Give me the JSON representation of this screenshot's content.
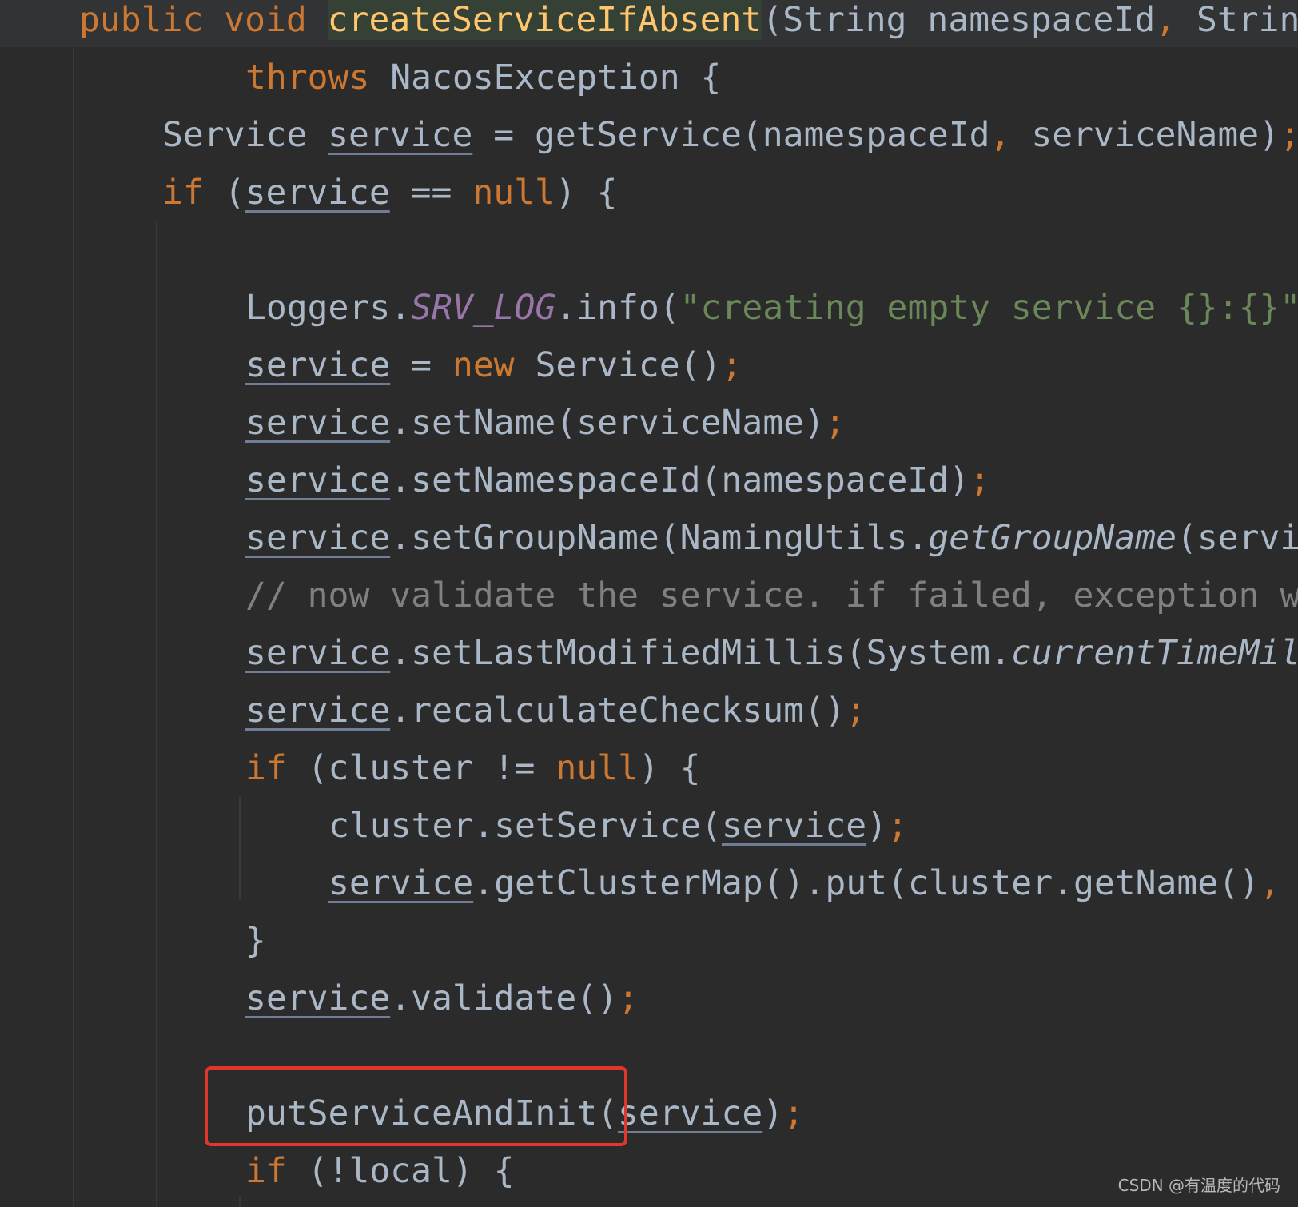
{
  "editor": {
    "theme_colors": {
      "background": "#2b2b2b",
      "keyword": "#cc7832",
      "plain": "#a9b7c6",
      "method_declaration": "#ffc66d",
      "string": "#6a8759",
      "comment": "#808080",
      "static_field": "#9876aa",
      "highlight_box": "#e0372a"
    },
    "highlighted_line": 19,
    "lines": [
      {
        "indent": 0,
        "tokens": [
          {
            "t": "public void ",
            "c": "kw"
          },
          {
            "t": "createServiceIfAbsent",
            "c": "md"
          },
          {
            "t": "(String namespaceId",
            "c": "pl"
          },
          {
            "t": ", ",
            "c": "kw"
          },
          {
            "t": "Strin",
            "c": "pl"
          }
        ]
      },
      {
        "indent": 8,
        "tokens": [
          {
            "t": "throws ",
            "c": "kw"
          },
          {
            "t": "NacosException {",
            "c": "pl"
          }
        ]
      },
      {
        "indent": 4,
        "tokens": [
          {
            "t": "Service ",
            "c": "pl"
          },
          {
            "t": "service",
            "c": "pl ul"
          },
          {
            "t": " = getService(namespaceId",
            "c": "pl"
          },
          {
            "t": ", ",
            "c": "kw"
          },
          {
            "t": "serviceName)",
            "c": "pl"
          },
          {
            "t": ";",
            "c": "kw"
          }
        ]
      },
      {
        "indent": 4,
        "tokens": [
          {
            "t": "if ",
            "c": "kw"
          },
          {
            "t": "(",
            "c": "pl"
          },
          {
            "t": "service",
            "c": "pl ul"
          },
          {
            "t": " == ",
            "c": "pl"
          },
          {
            "t": "null",
            "c": "kw"
          },
          {
            "t": ") {",
            "c": "pl"
          }
        ]
      },
      {
        "indent": 0,
        "tokens": []
      },
      {
        "indent": 8,
        "tokens": [
          {
            "t": "Loggers.",
            "c": "pl"
          },
          {
            "t": "SRV_LOG",
            "c": "sf"
          },
          {
            "t": ".info(",
            "c": "pl"
          },
          {
            "t": "\"creating empty service {}:{}\"",
            "c": "st"
          }
        ]
      },
      {
        "indent": 8,
        "tokens": [
          {
            "t": "service",
            "c": "pl ul"
          },
          {
            "t": " = ",
            "c": "pl"
          },
          {
            "t": "new ",
            "c": "kw"
          },
          {
            "t": "Service()",
            "c": "pl"
          },
          {
            "t": ";",
            "c": "kw"
          }
        ]
      },
      {
        "indent": 8,
        "tokens": [
          {
            "t": "service",
            "c": "pl ul"
          },
          {
            "t": ".setName(serviceName)",
            "c": "pl"
          },
          {
            "t": ";",
            "c": "kw"
          }
        ]
      },
      {
        "indent": 8,
        "tokens": [
          {
            "t": "service",
            "c": "pl ul"
          },
          {
            "t": ".setNamespaceId(namespaceId)",
            "c": "pl"
          },
          {
            "t": ";",
            "c": "kw"
          }
        ]
      },
      {
        "indent": 8,
        "tokens": [
          {
            "t": "service",
            "c": "pl ul"
          },
          {
            "t": ".setGroupName(NamingUtils.",
            "c": "pl"
          },
          {
            "t": "getGroupName",
            "c": "pl it"
          },
          {
            "t": "(servi",
            "c": "pl"
          }
        ]
      },
      {
        "indent": 8,
        "tokens": [
          {
            "t": "// now validate the service. if failed, exception w",
            "c": "cm"
          }
        ]
      },
      {
        "indent": 8,
        "tokens": [
          {
            "t": "service",
            "c": "pl ul"
          },
          {
            "t": ".setLastModifiedMillis(System.",
            "c": "pl"
          },
          {
            "t": "currentTimeMil",
            "c": "pl it"
          }
        ]
      },
      {
        "indent": 8,
        "tokens": [
          {
            "t": "service",
            "c": "pl ul"
          },
          {
            "t": ".recalculateChecksum()",
            "c": "pl"
          },
          {
            "t": ";",
            "c": "kw"
          }
        ]
      },
      {
        "indent": 8,
        "tokens": [
          {
            "t": "if ",
            "c": "kw"
          },
          {
            "t": "(cluster != ",
            "c": "pl"
          },
          {
            "t": "null",
            "c": "kw"
          },
          {
            "t": ") {",
            "c": "pl"
          }
        ]
      },
      {
        "indent": 12,
        "tokens": [
          {
            "t": "cluster.setService(",
            "c": "pl"
          },
          {
            "t": "service",
            "c": "pl ul"
          },
          {
            "t": ")",
            "c": "pl"
          },
          {
            "t": ";",
            "c": "kw"
          }
        ]
      },
      {
        "indent": 12,
        "tokens": [
          {
            "t": "service",
            "c": "pl ul"
          },
          {
            "t": ".getClusterMap().put(cluster.getName()",
            "c": "pl"
          },
          {
            "t": ",",
            "c": "kw"
          }
        ]
      },
      {
        "indent": 8,
        "tokens": [
          {
            "t": "}",
            "c": "pl"
          }
        ]
      },
      {
        "indent": 8,
        "tokens": [
          {
            "t": "service",
            "c": "pl ul"
          },
          {
            "t": ".validate()",
            "c": "pl"
          },
          {
            "t": ";",
            "c": "kw"
          }
        ]
      },
      {
        "indent": 0,
        "tokens": []
      },
      {
        "indent": 8,
        "tokens": [
          {
            "t": "putServiceAndInit(",
            "c": "pl"
          },
          {
            "t": "service",
            "c": "pl ul"
          },
          {
            "t": ")",
            "c": "pl"
          },
          {
            "t": ";",
            "c": "kw"
          }
        ]
      },
      {
        "indent": 8,
        "tokens": [
          {
            "t": "if ",
            "c": "kw"
          },
          {
            "t": "(!local) {",
            "c": "pl"
          }
        ]
      }
    ]
  },
  "watermark": "CSDN @有温度的代码"
}
